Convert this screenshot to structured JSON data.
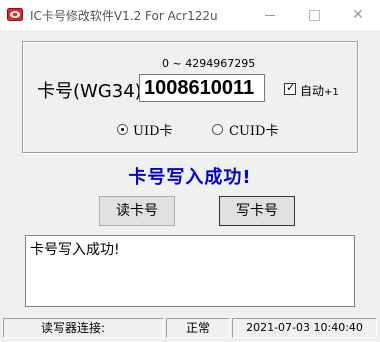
{
  "window": {
    "title": "IC卡号修改软件V1.2 For Acr122u",
    "icon_name": "app-icon",
    "controls": {
      "minimize": "minimize-icon",
      "maximize": "maximize-icon",
      "close": "close-icon",
      "close_glyph": "✕"
    }
  },
  "card": {
    "range_hint": "0 ~ 4294967295",
    "label": "卡号(WG34)",
    "value": "1008610011",
    "auto_increment": {
      "checked": true,
      "label": "自动",
      "suffix": "+1"
    }
  },
  "mode": {
    "options": [
      {
        "label": "UID卡",
        "selected": true
      },
      {
        "label": "CUID卡",
        "selected": false
      }
    ]
  },
  "status_message": "卡号写入成功!",
  "status_color": "#0000cc",
  "buttons": {
    "read": "读卡号",
    "write": "写卡号"
  },
  "log_text": "卡号写入成功!",
  "statusbar": {
    "reader_label": "读写器连接:",
    "state": "正常",
    "datetime": "2021-07-03 10:40:40"
  }
}
